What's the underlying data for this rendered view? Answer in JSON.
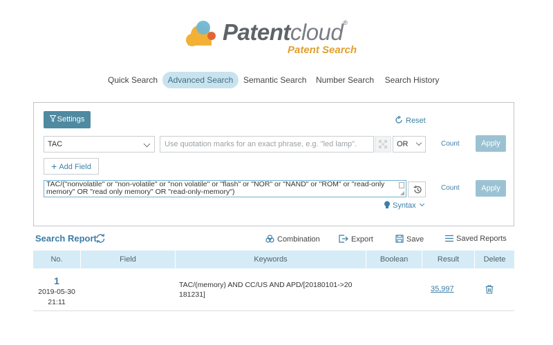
{
  "logo": {
    "brand_bold": "Patent",
    "brand_light": "cloud",
    "registered": "®",
    "subtitle": "Patent Search"
  },
  "nav": {
    "tabs": [
      {
        "label": "Quick Search",
        "active": false
      },
      {
        "label": "Advanced Search",
        "active": true
      },
      {
        "label": "Semantic Search",
        "active": false
      },
      {
        "label": "Number Search",
        "active": false
      },
      {
        "label": "Search History",
        "active": false
      }
    ]
  },
  "search_panel": {
    "settings_label": "Settings",
    "reset_label": "Reset",
    "field_select_value": "TAC",
    "keyword_placeholder": "Use quotation marks for an exact phrase, e.g. \"led lamp\".",
    "boolean_value": "OR",
    "count_label": "Count",
    "apply_label": "Apply",
    "add_field_label": "Add Field",
    "query_line1": "TAC/(\"nonvolatile\" or \"non-volatile\" or \"non volatile\" or \"flash\" or \"NOR\" or \"NAND\" or \"ROM\" or \"read-only",
    "query_line2": "memory\" OR \"read only memory\" OR \"read-only-memory\")",
    "syntax_label": "Syntax"
  },
  "report": {
    "title": "Search Report",
    "tools": {
      "combination": "Combination",
      "export": "Export",
      "save": "Save",
      "saved_reports": "Saved Reports"
    },
    "columns": [
      "No.",
      "Field",
      "Keywords",
      "Boolean",
      "Result",
      "Delete"
    ],
    "rows": [
      {
        "no": "1",
        "date": "2019-05-30",
        "time": "21:11",
        "keywords_line1": "TAC/(memory) AND CC/US AND APD/[20180101->20",
        "keywords_line2": "181231]",
        "result": "35,997"
      }
    ]
  },
  "colors": {
    "accent": "#4f8aa0",
    "link": "#3b80a6",
    "table_header": "#d5ecf6",
    "logo_orange": "#e0a030"
  }
}
